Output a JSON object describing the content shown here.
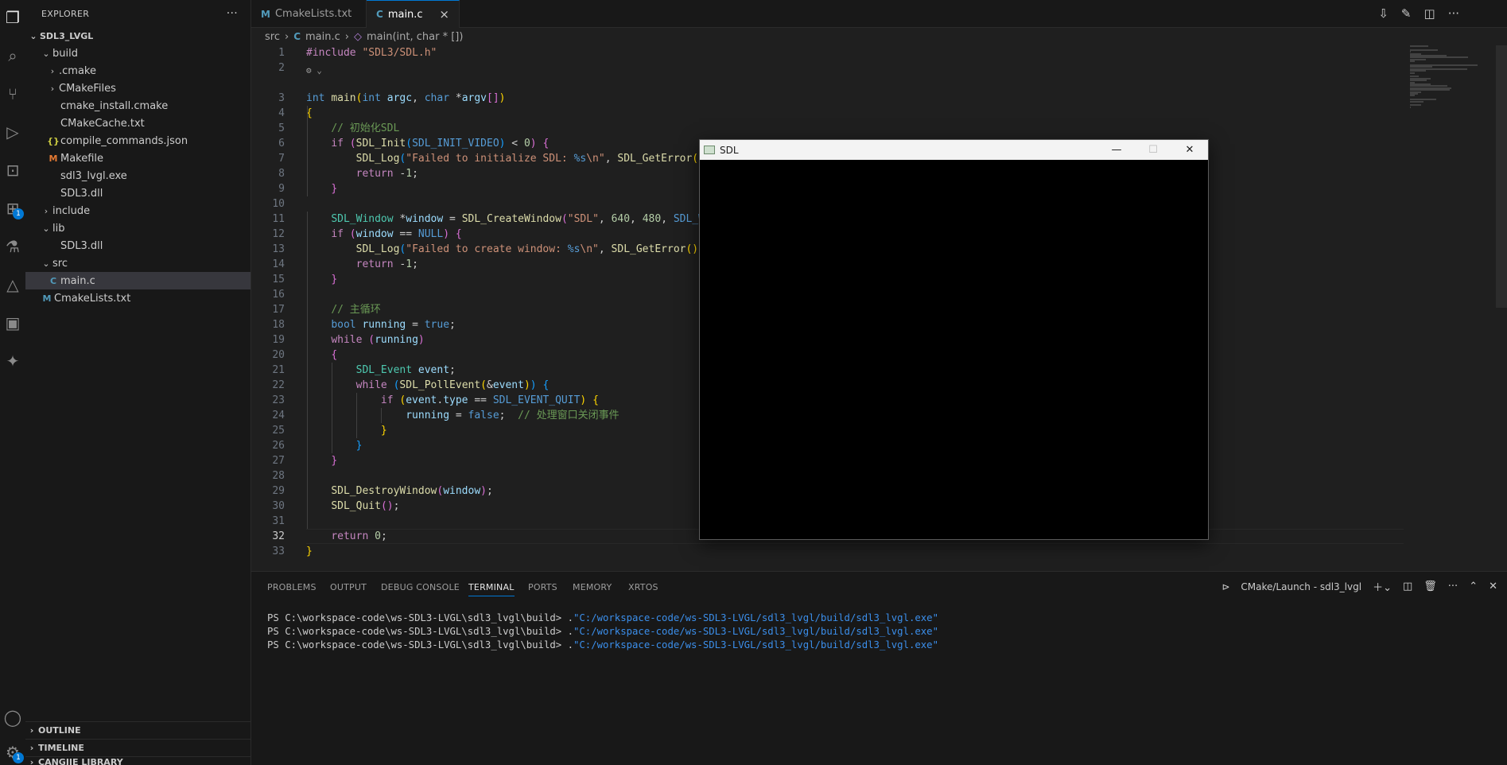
{
  "activity_bar": {
    "items": [
      {
        "name": "explorer-icon"
      },
      {
        "name": "search-icon"
      },
      {
        "name": "source-control-icon"
      },
      {
        "name": "run-debug-icon"
      },
      {
        "name": "remote-explorer-icon"
      },
      {
        "name": "extensions-icon",
        "badge": "1"
      },
      {
        "name": "testing-icon"
      },
      {
        "name": "cmake-icon"
      },
      {
        "name": "chip-icon"
      },
      {
        "name": "puzzle-icon"
      }
    ],
    "bottom": [
      {
        "name": "account-icon"
      },
      {
        "name": "manage-gear-icon",
        "badge": "1"
      }
    ]
  },
  "sidebar": {
    "title": "EXPLORER",
    "more": "···",
    "root": "SDL3_LVGL",
    "tree": [
      {
        "label": "build",
        "type": "folder-open",
        "depth": 1
      },
      {
        "label": ".cmake",
        "type": "folder",
        "depth": 2
      },
      {
        "label": "CMakeFiles",
        "type": "folder",
        "depth": 2
      },
      {
        "label": "cmake_install.cmake",
        "type": "file",
        "depth": 2
      },
      {
        "label": "CMakeCache.txt",
        "type": "file",
        "depth": 2
      },
      {
        "label": "compile_commands.json",
        "type": "json",
        "depth": 2
      },
      {
        "label": "Makefile",
        "type": "makefile",
        "depth": 2
      },
      {
        "label": "sdl3_lvgl.exe",
        "type": "file",
        "depth": 2
      },
      {
        "label": "SDL3.dll",
        "type": "file",
        "depth": 2
      },
      {
        "label": "include",
        "type": "folder",
        "depth": 1
      },
      {
        "label": "lib",
        "type": "folder-open",
        "depth": 1
      },
      {
        "label": "SDL3.dll",
        "type": "file",
        "depth": 2
      },
      {
        "label": "src",
        "type": "folder-open",
        "depth": 1
      },
      {
        "label": "main.c",
        "type": "c",
        "depth": 2,
        "selected": true
      },
      {
        "label": "CmakeLists.txt",
        "type": "cmake",
        "depth": 1
      }
    ],
    "sections": [
      "OUTLINE",
      "TIMELINE",
      "CANGJIE LIBRARY"
    ]
  },
  "tabs": [
    {
      "label": "CmakeLists.txt",
      "icon": "M",
      "active": false
    },
    {
      "label": "main.c",
      "icon": "C",
      "active": true,
      "close": "×"
    }
  ],
  "breadcrumb": {
    "folder": "src",
    "file": "main.c",
    "symbol": "main(int, char * [])"
  },
  "editor": {
    "current_line": 32,
    "codelens": "⚙ ⌄"
  },
  "sdl_window": {
    "title": "SDL",
    "minimize": "—",
    "maximize": "☐",
    "close": "✕"
  },
  "panel": {
    "tabs": [
      "PROBLEMS",
      "OUTPUT",
      "DEBUG CONSOLE",
      "TERMINAL",
      "PORTS",
      "MEMORY",
      "XRTOS"
    ],
    "active_tab": "TERMINAL",
    "terminal_name": "CMake/Launch - sdl3_lvgl",
    "lines": [
      {
        "prompt": "PS C:\\workspace-code\\ws-SDL3-LVGL\\sdl3_lvgl\\build> ",
        "cmd": ".",
        "path": "\"C:/workspace-code/ws-SDL3-LVGL/sdl3_lvgl/build/sdl3_lvgl.exe\""
      },
      {
        "prompt": "PS C:\\workspace-code\\ws-SDL3-LVGL\\sdl3_lvgl\\build> ",
        "cmd": ".",
        "path": "\"C:/workspace-code/ws-SDL3-LVGL/sdl3_lvgl/build/sdl3_lvgl.exe\""
      },
      {
        "prompt": "PS C:\\workspace-code\\ws-SDL3-LVGL\\sdl3_lvgl\\build> ",
        "cmd": ".",
        "path": "\"C:/workspace-code/ws-SDL3-LVGL/sdl3_lvgl/build/sdl3_lvgl.exe\""
      }
    ]
  },
  "code": [
    {
      "n": 1,
      "html": "<span class='c'>#include</span> <span class='s'>\"SDL3/SDL.h\"</span>"
    },
    {
      "n": 2,
      "html": ""
    },
    {
      "n": 3,
      "html": "<span class='k'>int</span> <span class='f'>main</span><span class='p1'>(</span><span class='k'>int</span> <span class='v'>argc</span>, <span class='k'>char</span> *<span class='v'>argv</span><span class='p2'>[]</span><span class='p1'>)</span>"
    },
    {
      "n": 4,
      "html": "<span class='p1'>{</span>"
    },
    {
      "n": 5,
      "html": "    <span class='cm'>// 初始化SDL</span>"
    },
    {
      "n": 6,
      "html": "    <span class='c'>if</span> <span class='p2'>(</span><span class='f'>SDL_Init</span><span class='p3'>(</span><span class='m'>SDL_INIT_VIDEO</span><span class='p3'>)</span> &lt; <span class='n'>0</span><span class='p2'>)</span> <span class='p2'>{</span>"
    },
    {
      "n": 7,
      "html": "        <span class='f'>SDL_Log</span><span class='p3'>(</span><span class='s'>\"Failed to initialize SDL: </span><span class='k'>%s</span><span class='s'>\\n\"</span>, <span class='f'>SDL_GetError</span><span class='p1'>()</span><span class='p3'>)</span>;"
    },
    {
      "n": 8,
      "html": "        <span class='c'>return</span> -<span class='n'>1</span>;"
    },
    {
      "n": 9,
      "html": "    <span class='p2'>}</span>"
    },
    {
      "n": 10,
      "html": ""
    },
    {
      "n": 11,
      "html": "    <span class='t'>SDL_Window</span> *<span class='v'>window</span> = <span class='f'>SDL_CreateWindow</span><span class='p2'>(</span><span class='s'>\"SDL\"</span>, <span class='n'>640</span>, <span class='n'>480</span>, <span class='m'>SDL_WINDOW_SHOWN</span><span class='p2'>)</span>;"
    },
    {
      "n": 12,
      "html": "    <span class='c'>if</span> <span class='p2'>(</span><span class='v'>window</span> == <span class='k'>NULL</span><span class='p2'>)</span> <span class='p2'>{</span>"
    },
    {
      "n": 13,
      "html": "        <span class='f'>SDL_Log</span><span class='p3'>(</span><span class='s'>\"Failed to create window: </span><span class='k'>%s</span><span class='s'>\\n\"</span>, <span class='f'>SDL_GetError</span><span class='p1'>()</span><span class='p3'>)</span>;"
    },
    {
      "n": 14,
      "html": "        <span class='c'>return</span> -<span class='n'>1</span>;"
    },
    {
      "n": 15,
      "html": "    <span class='p2'>}</span>"
    },
    {
      "n": 16,
      "html": ""
    },
    {
      "n": 17,
      "html": "    <span class='cm'>// 主循环</span>"
    },
    {
      "n": 18,
      "html": "    <span class='k'>bool</span> <span class='v'>running</span> = <span class='k'>true</span>;"
    },
    {
      "n": 19,
      "html": "    <span class='c'>while</span> <span class='p2'>(</span><span class='v'>running</span><span class='p2'>)</span>"
    },
    {
      "n": 20,
      "html": "    <span class='p2'>{</span>"
    },
    {
      "n": 21,
      "html": "        <span class='t'>SDL_Event</span> <span class='v'>event</span>;"
    },
    {
      "n": 22,
      "html": "        <span class='c'>while</span> <span class='p3'>(</span><span class='f'>SDL_PollEvent</span><span class='p1'>(</span>&amp;<span class='v'>event</span><span class='p1'>)</span><span class='p3'>)</span> <span class='p3'>{</span>"
    },
    {
      "n": 23,
      "html": "            <span class='c'>if</span> <span class='p1'>(</span><span class='v'>event</span>.<span class='v'>type</span> == <span class='m'>SDL_EVENT_QUIT</span><span class='p1'>)</span> <span class='p1'>{</span>"
    },
    {
      "n": 24,
      "html": "                <span class='v'>running</span> = <span class='k'>false</span>;  <span class='cm'>// 处理窗口关闭事件</span>"
    },
    {
      "n": 25,
      "html": "            <span class='p1'>}</span>"
    },
    {
      "n": 26,
      "html": "        <span class='p3'>}</span>"
    },
    {
      "n": 27,
      "html": "    <span class='p2'>}</span>"
    },
    {
      "n": 28,
      "html": ""
    },
    {
      "n": 29,
      "html": "    <span class='f'>SDL_DestroyWindow</span><span class='p2'>(</span><span class='v'>window</span><span class='p2'>)</span>;"
    },
    {
      "n": 30,
      "html": "    <span class='f'>SDL_Quit</span><span class='p2'>()</span>;"
    },
    {
      "n": 31,
      "html": ""
    },
    {
      "n": 32,
      "html": "    <span class='c'>return</span> <span class='n'>0</span>;"
    },
    {
      "n": 33,
      "html": "<span class='p1'>}</span>"
    }
  ]
}
